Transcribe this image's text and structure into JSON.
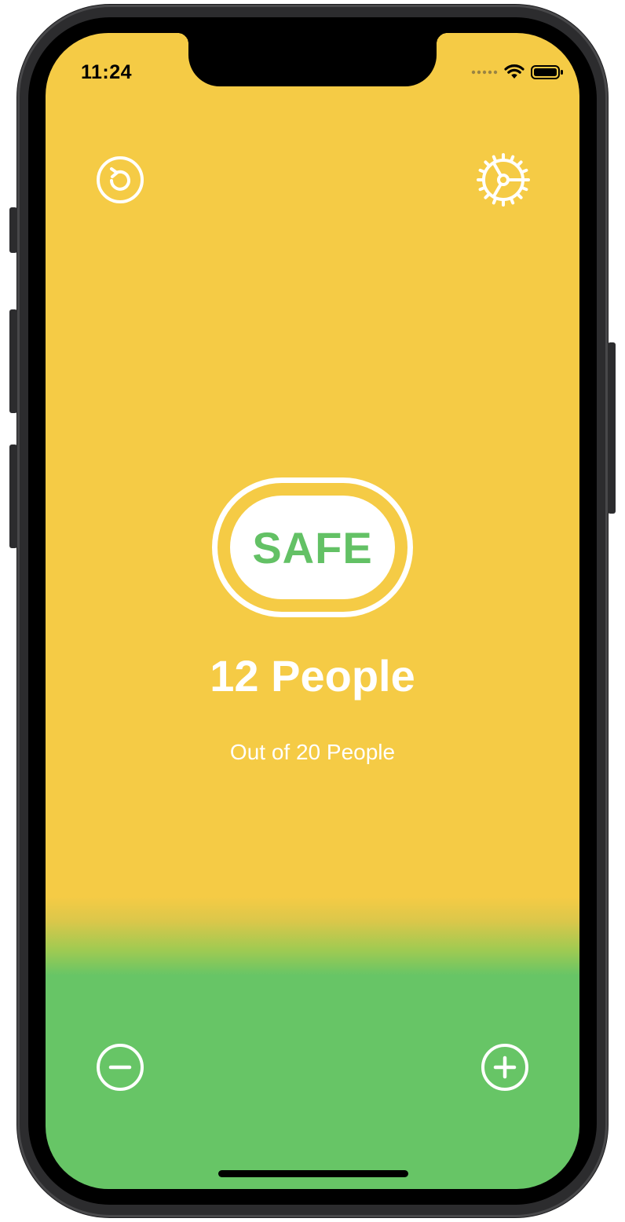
{
  "status_bar": {
    "time": "11:24",
    "icons": [
      "cellular-dots-icon",
      "wifi-icon",
      "battery-icon"
    ]
  },
  "toolbar": {
    "reset_icon": "counterclockwise-arrow-circle-icon",
    "settings_icon": "gear-icon"
  },
  "status": {
    "label": "SAFE",
    "label_color": "#63c165"
  },
  "counter": {
    "count_text": "12 People",
    "capacity_text": "Out of 20 People",
    "count": 12,
    "capacity": 20
  },
  "controls": {
    "decrement_icon": "minus-circle-icon",
    "increment_icon": "plus-circle-icon"
  },
  "colors": {
    "background_top": "#f5cb45",
    "background_bottom": "#67c566",
    "foreground": "#ffffff"
  }
}
